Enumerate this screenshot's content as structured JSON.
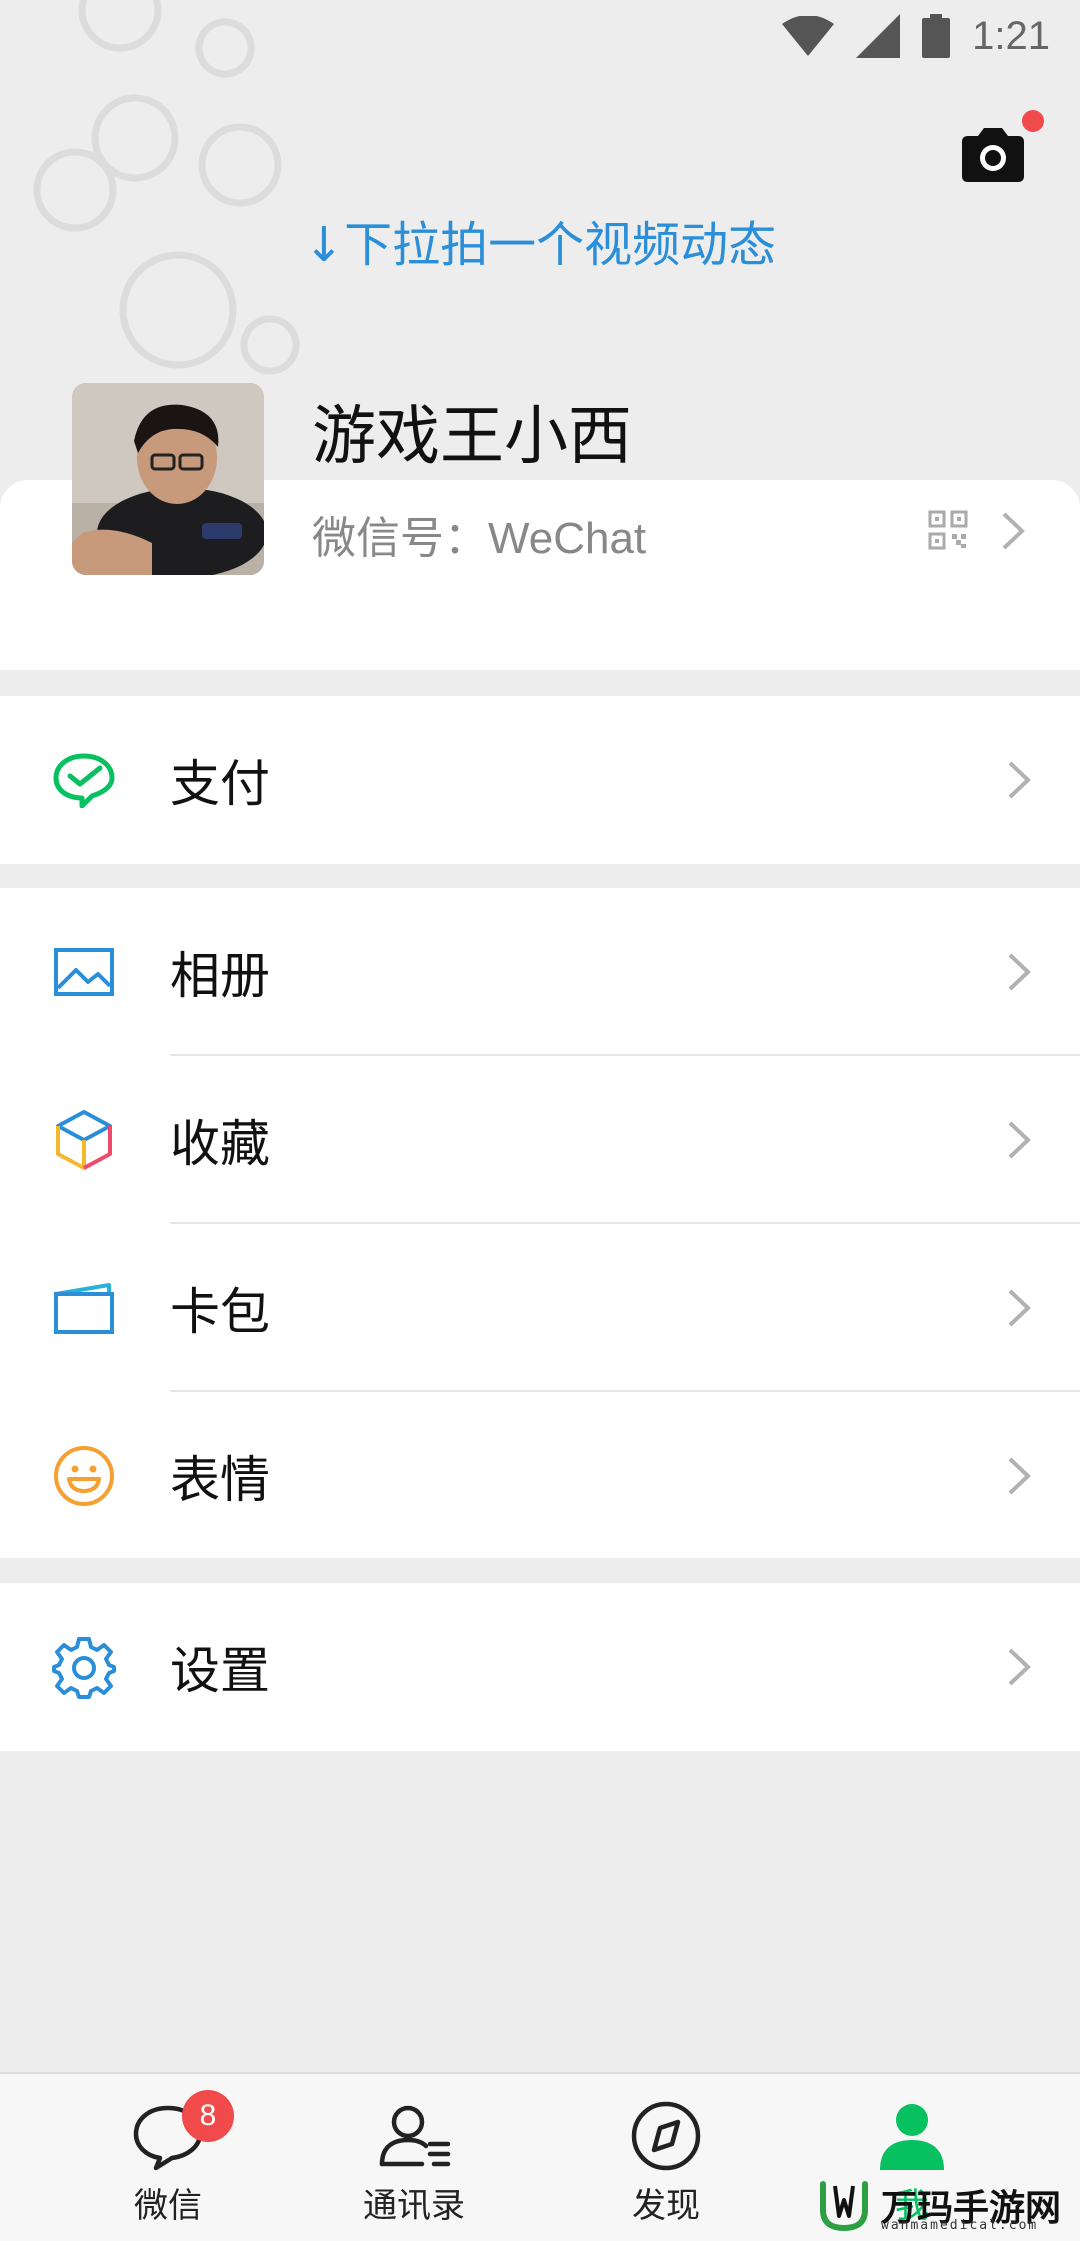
{
  "status_bar": {
    "time": "1:21"
  },
  "header": {
    "pull_hint": "↓下拉拍一个视频动态"
  },
  "profile": {
    "nickname": "游戏王小西",
    "wechat_id_label": "微信号：",
    "wechat_id": "WeChat"
  },
  "menu": {
    "pay": "支付",
    "album": "相册",
    "favorites": "收藏",
    "cards": "卡包",
    "stickers": "表情",
    "settings": "设置"
  },
  "tabbar": {
    "chats": "微信",
    "chats_badge": "8",
    "contacts": "通讯录",
    "discover": "发现",
    "me": "我"
  },
  "watermark": {
    "title": "万玛手游网",
    "subtitle": "wanmamedical.com"
  },
  "colors": {
    "accent_blue": "#2a8fd8",
    "wechat_green": "#07c160",
    "badge_red": "#f04a4a"
  }
}
